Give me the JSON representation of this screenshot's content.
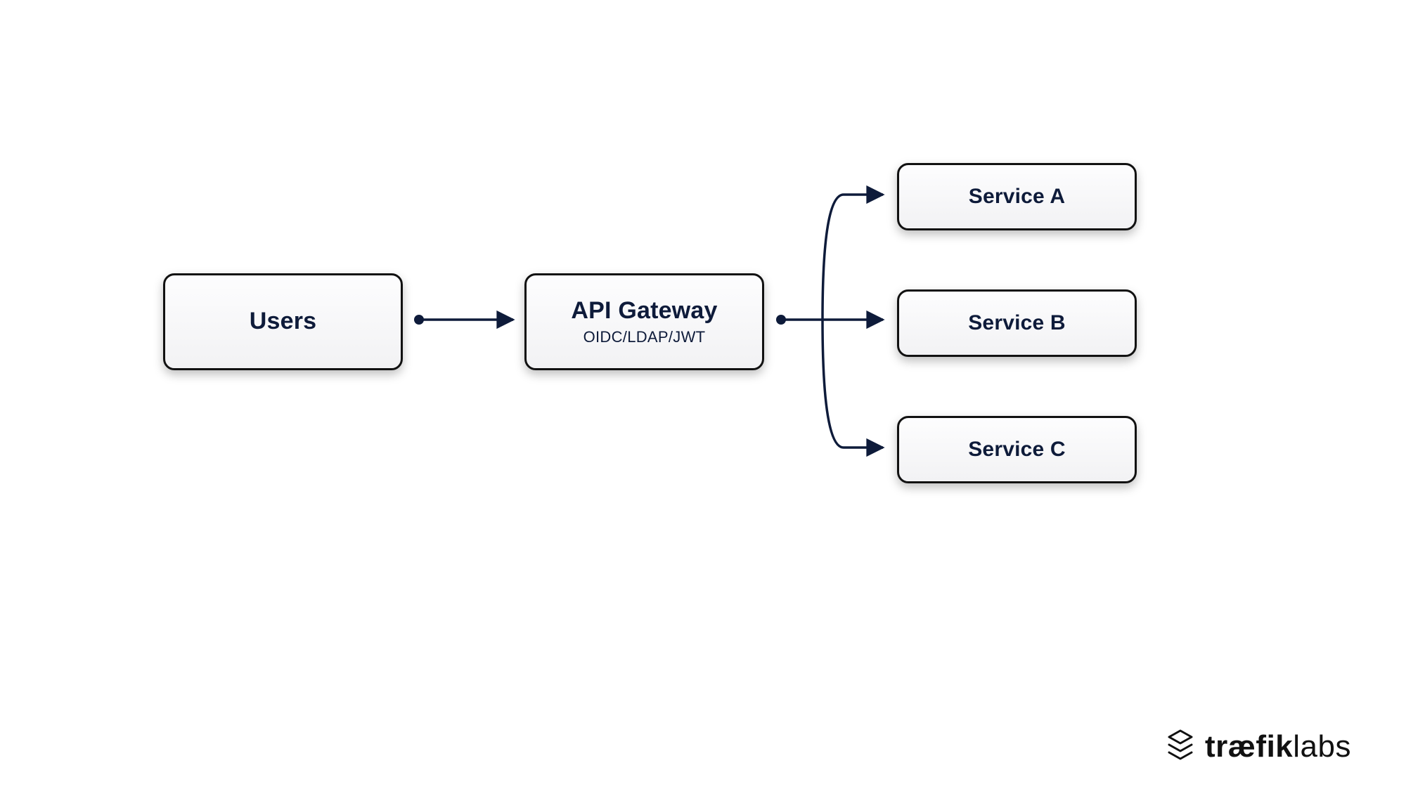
{
  "nodes": {
    "users": {
      "title": "Users"
    },
    "gateway": {
      "title": "API Gateway",
      "subtitle": "OIDC/LDAP/JWT"
    },
    "serviceA": {
      "title": "Service A"
    },
    "serviceB": {
      "title": "Service B"
    },
    "serviceC": {
      "title": "Service C"
    }
  },
  "brand": {
    "bold": "træfik",
    "thin": "labs"
  },
  "colors": {
    "text": "#0e1b3a",
    "stroke": "#0e1b3a"
  }
}
